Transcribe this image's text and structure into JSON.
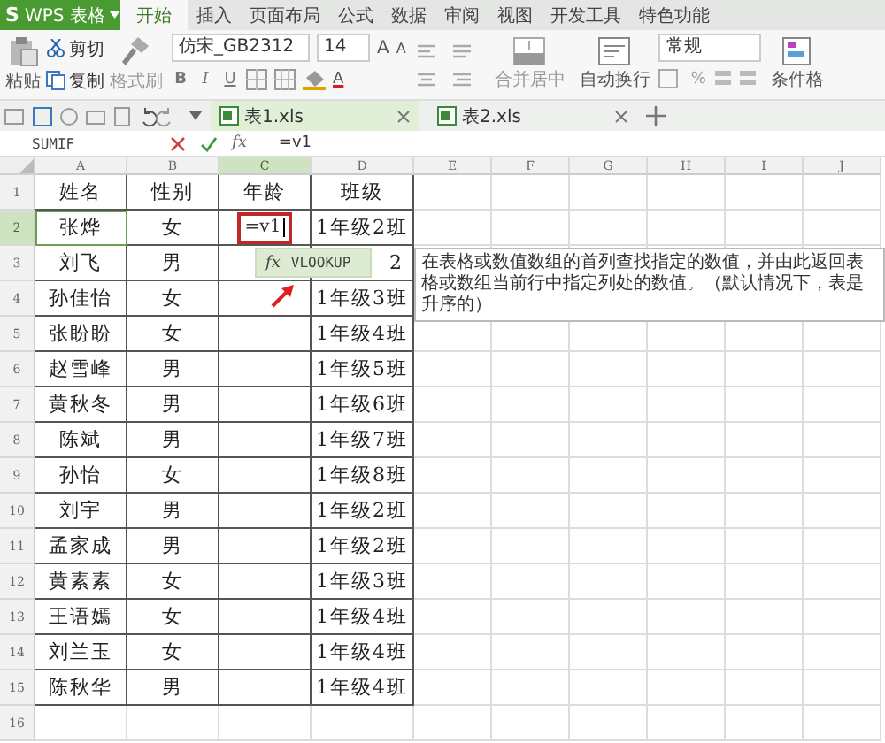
{
  "app_menu": {
    "logo": "S",
    "title": "WPS 表格"
  },
  "menu_tabs": [
    {
      "label": "开始",
      "selected": true
    },
    {
      "label": "插入",
      "selected": false
    },
    {
      "label": "页面布局",
      "selected": false
    },
    {
      "label": "公式",
      "selected": false
    },
    {
      "label": "数据",
      "selected": false
    },
    {
      "label": "审阅",
      "selected": false
    },
    {
      "label": "视图",
      "selected": false
    },
    {
      "label": "开发工具",
      "selected": false
    },
    {
      "label": "特色功能",
      "selected": false
    }
  ],
  "ribbon": {
    "paste": "粘贴",
    "cut": "剪切",
    "copy": "复制",
    "format_painter": "格式刷",
    "font_name": "仿宋_GB2312",
    "font_size": "14",
    "grow_font": "A",
    "shrink_font": "A",
    "styles": [
      "B",
      "I",
      "U"
    ],
    "font_color": "A",
    "merge": "合并居中",
    "wrap": "自动换行",
    "number_format": "常规",
    "percent": "%",
    "conditional_format": "条件格"
  },
  "doc_tabs": [
    {
      "label": "表1.xls",
      "selected": true
    },
    {
      "label": "表2.xls",
      "selected": false
    }
  ],
  "formula_bar": {
    "name_box": "SUMIF",
    "fx": "fx",
    "formula": "=v1"
  },
  "columns": [
    {
      "label": "A",
      "selected": false
    },
    {
      "label": "B",
      "selected": false
    },
    {
      "label": "C",
      "selected": true
    },
    {
      "label": "D",
      "selected": false
    },
    {
      "label": "E",
      "selected": false
    },
    {
      "label": "F",
      "selected": false
    },
    {
      "label": "G",
      "selected": false
    },
    {
      "label": "H",
      "selected": false
    },
    {
      "label": "I",
      "selected": false
    },
    {
      "label": "J",
      "selected": false
    }
  ],
  "rows": [
    {
      "num": "1",
      "selected": false,
      "cells": [
        "姓名",
        "性别",
        "年龄",
        "班级"
      ]
    },
    {
      "num": "2",
      "selected": true,
      "cells": [
        "张烨",
        "女",
        "=v1",
        "1年级2班"
      ]
    },
    {
      "num": "3",
      "selected": false,
      "cells": [
        "刘飞",
        "男",
        null,
        "2"
      ],
      "popup": {
        "icon": "fx",
        "item": "VLOOKUP",
        "description": "在表格或数值数组的首列查找指定的数值，并由此返回表格或数组当前行中指定列处的数值。（默认情况下，表是升序的）"
      }
    },
    {
      "num": "4",
      "selected": false,
      "cells": [
        "孙佳怡",
        "女",
        null,
        "1年级3班"
      ]
    },
    {
      "num": "5",
      "selected": false,
      "cells": [
        "张盼盼",
        "女",
        null,
        "1年级4班"
      ]
    },
    {
      "num": "6",
      "selected": false,
      "cells": [
        "赵雪峰",
        "男",
        null,
        "1年级5班"
      ]
    },
    {
      "num": "7",
      "selected": false,
      "cells": [
        "黄秋冬",
        "男",
        null,
        "1年级6班"
      ]
    },
    {
      "num": "8",
      "selected": false,
      "cells": [
        "陈斌",
        "男",
        null,
        "1年级7班"
      ]
    },
    {
      "num": "9",
      "selected": false,
      "cells": [
        "孙怡",
        "女",
        null,
        "1年级8班"
      ]
    },
    {
      "num": "10",
      "selected": false,
      "cells": [
        "刘宇",
        "男",
        null,
        "1年级2班"
      ]
    },
    {
      "num": "11",
      "selected": false,
      "cells": [
        "孟家成",
        "男",
        null,
        "1年级2班"
      ]
    },
    {
      "num": "12",
      "selected": false,
      "cells": [
        "黄素素",
        "女",
        null,
        "1年级3班"
      ]
    },
    {
      "num": "13",
      "selected": false,
      "cells": [
        "王语嫣",
        "女",
        null,
        "1年级4班"
      ]
    },
    {
      "num": "14",
      "selected": false,
      "cells": [
        "刘兰玉",
        "女",
        null,
        "1年级4班"
      ]
    },
    {
      "num": "15",
      "selected": false,
      "cells": [
        "陈秋华",
        "男",
        null,
        "1年级4班"
      ]
    },
    {
      "num": "16",
      "selected": false
    }
  ]
}
